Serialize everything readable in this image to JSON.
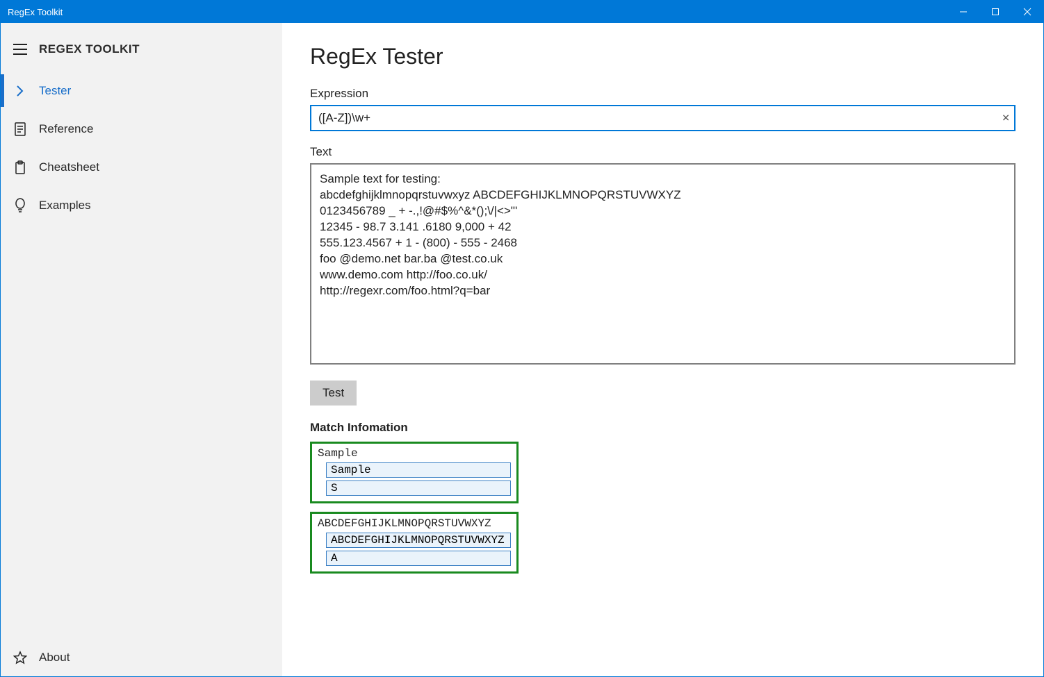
{
  "window": {
    "title": "RegEx Toolkit"
  },
  "sidebar": {
    "title": "REGEX TOOLKIT",
    "items": [
      {
        "label": "Tester",
        "icon": "chevron-right-icon",
        "active": true
      },
      {
        "label": "Reference",
        "icon": "document-icon",
        "active": false
      },
      {
        "label": "Cheatsheet",
        "icon": "clipboard-icon",
        "active": false
      },
      {
        "label": "Examples",
        "icon": "lightbulb-icon",
        "active": false
      }
    ],
    "footer": {
      "label": "About",
      "icon": "star-icon"
    }
  },
  "main": {
    "title": "RegEx Tester",
    "expression_label": "Expression",
    "expression_value": "([A-Z])\\w+",
    "text_label": "Text",
    "text_value": "Sample text for testing:\nabcdefghijklmnopqrstuvwxyz ABCDEFGHIJKLMNOPQRSTUVWXYZ\n0123456789 _ + -.,!@#$%^&*();\\/|<>\"'\n12345 - 98.7 3.141 .6180 9,000 + 42\n555.123.4567 + 1 - (800) - 555 - 2468\nfoo @demo.net bar.ba @test.co.uk\nwww.demo.com http://foo.co.uk/\nhttp://regexr.com/foo.html?q=bar",
    "test_button": "Test",
    "match_title": "Match Infomation",
    "matches": [
      {
        "match": "Sample",
        "groups": [
          "Sample",
          "S"
        ]
      },
      {
        "match": "ABCDEFGHIJKLMNOPQRSTUVWXYZ",
        "groups": [
          "ABCDEFGHIJKLMNOPQRSTUVWXYZ",
          "A"
        ]
      }
    ]
  }
}
